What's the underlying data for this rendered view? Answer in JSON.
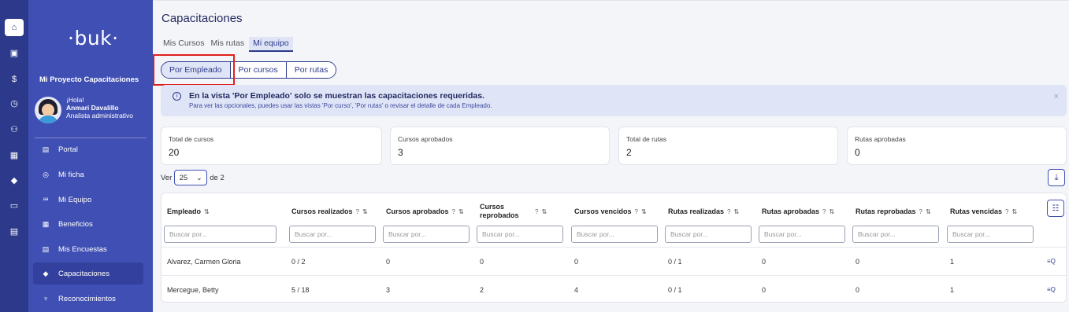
{
  "rail": {
    "icons": [
      "home-icon",
      "checklist-icon",
      "dollar-icon",
      "clock-icon",
      "people-icon",
      "briefcase-icon",
      "graduation-icon",
      "folder-icon",
      "register-icon"
    ]
  },
  "sidebar": {
    "logo": "·buk·",
    "project": "Mi Proyecto Capacitaciones",
    "greeting": "¡Hola!",
    "user_name": "Anmari Davalillo",
    "user_role": "Analista administrativo",
    "items": [
      {
        "label": "Portal",
        "icon": "document-icon",
        "glyph": "▤"
      },
      {
        "label": "Mi ficha",
        "icon": "user-circle-icon",
        "glyph": "◎"
      },
      {
        "label": "Mi Equipo",
        "icon": "team-icon",
        "glyph": "ᵃᵃ"
      },
      {
        "label": "Beneficios",
        "icon": "gift-icon",
        "glyph": "▦"
      },
      {
        "label": "Mis Encuestas",
        "icon": "survey-icon",
        "glyph": "▤"
      },
      {
        "label": "Capacitaciones",
        "icon": "graduation-cap-icon",
        "glyph": "◆"
      },
      {
        "label": "Reconocimientos",
        "icon": "trophy-icon",
        "glyph": "♆"
      }
    ]
  },
  "main": {
    "title": "Capacitaciones",
    "tabs": [
      {
        "label": "Mis Cursos"
      },
      {
        "label": "Mis rutas"
      },
      {
        "label": "Mi equipo"
      }
    ],
    "view_buttons": [
      {
        "label": "Por Empleado"
      },
      {
        "label": "Por cursos"
      },
      {
        "label": "Por rutas"
      }
    ],
    "alert": {
      "title": "En la vista 'Por Empleado' solo se muestran las capacitaciones requeridas.",
      "body": "Para ver las opcionales, puedes usar las vistas 'Por curso', 'Por rutas' o revisar el detalle de cada Empleado.",
      "close": "×",
      "icon": "i"
    },
    "stats": [
      {
        "label": "Total de cursos",
        "value": "20"
      },
      {
        "label": "Cursos aprobados",
        "value": "3"
      },
      {
        "label": "Total de rutas",
        "value": "2"
      },
      {
        "label": "Rutas aprobadas",
        "value": "0"
      }
    ],
    "pagination": {
      "prefix": "Ver",
      "per_page": "25",
      "suffix": "de 2"
    },
    "download_icon": "⤓",
    "settings_icon": "☷"
  },
  "table": {
    "filter_placeholder": "Buscar por...",
    "columns": [
      {
        "label": "Empleado",
        "help": ""
      },
      {
        "label": "Cursos realizados",
        "help": "?"
      },
      {
        "label": "Cursos aprobados",
        "help": "?"
      },
      {
        "label": "Cursos reprobados",
        "help": "?"
      },
      {
        "label": "Cursos vencidos",
        "help": "?"
      },
      {
        "label": "Rutas realizadas",
        "help": "?"
      },
      {
        "label": "Rutas aprobadas",
        "help": "?"
      },
      {
        "label": "Rutas reprobadas",
        "help": "?"
      },
      {
        "label": "Rutas vencidas",
        "help": "?"
      }
    ],
    "rows": [
      [
        "Alvarez, Carmen Gloria",
        "0 / 2",
        "0",
        "0",
        "0",
        "0 / 1",
        "0",
        "0",
        "1"
      ],
      [
        "Mercegue, Betty",
        "5 / 18",
        "3",
        "2",
        "4",
        "0 / 1",
        "0",
        "0",
        "1"
      ]
    ],
    "row_action_label": "≡Q"
  }
}
